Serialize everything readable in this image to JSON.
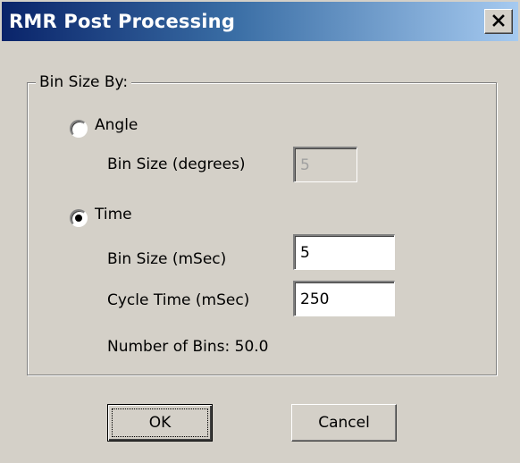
{
  "window": {
    "title": "RMR Post Processing",
    "close_icon": "close-icon"
  },
  "group": {
    "legend": "Bin Size By:"
  },
  "angle": {
    "option_label": "Angle",
    "selected": false,
    "bin_size_label": "Bin Size (degrees)",
    "bin_size_value": "5",
    "bin_size_disabled": true
  },
  "time": {
    "option_label": "Time",
    "selected": true,
    "bin_size_label": "Bin Size (mSec)",
    "bin_size_value": "5",
    "cycle_time_label": "Cycle Time (mSec)",
    "cycle_time_value": "250",
    "number_of_bins": "Number of Bins: 50.0"
  },
  "buttons": {
    "ok_label": "OK",
    "cancel_label": "Cancel"
  }
}
